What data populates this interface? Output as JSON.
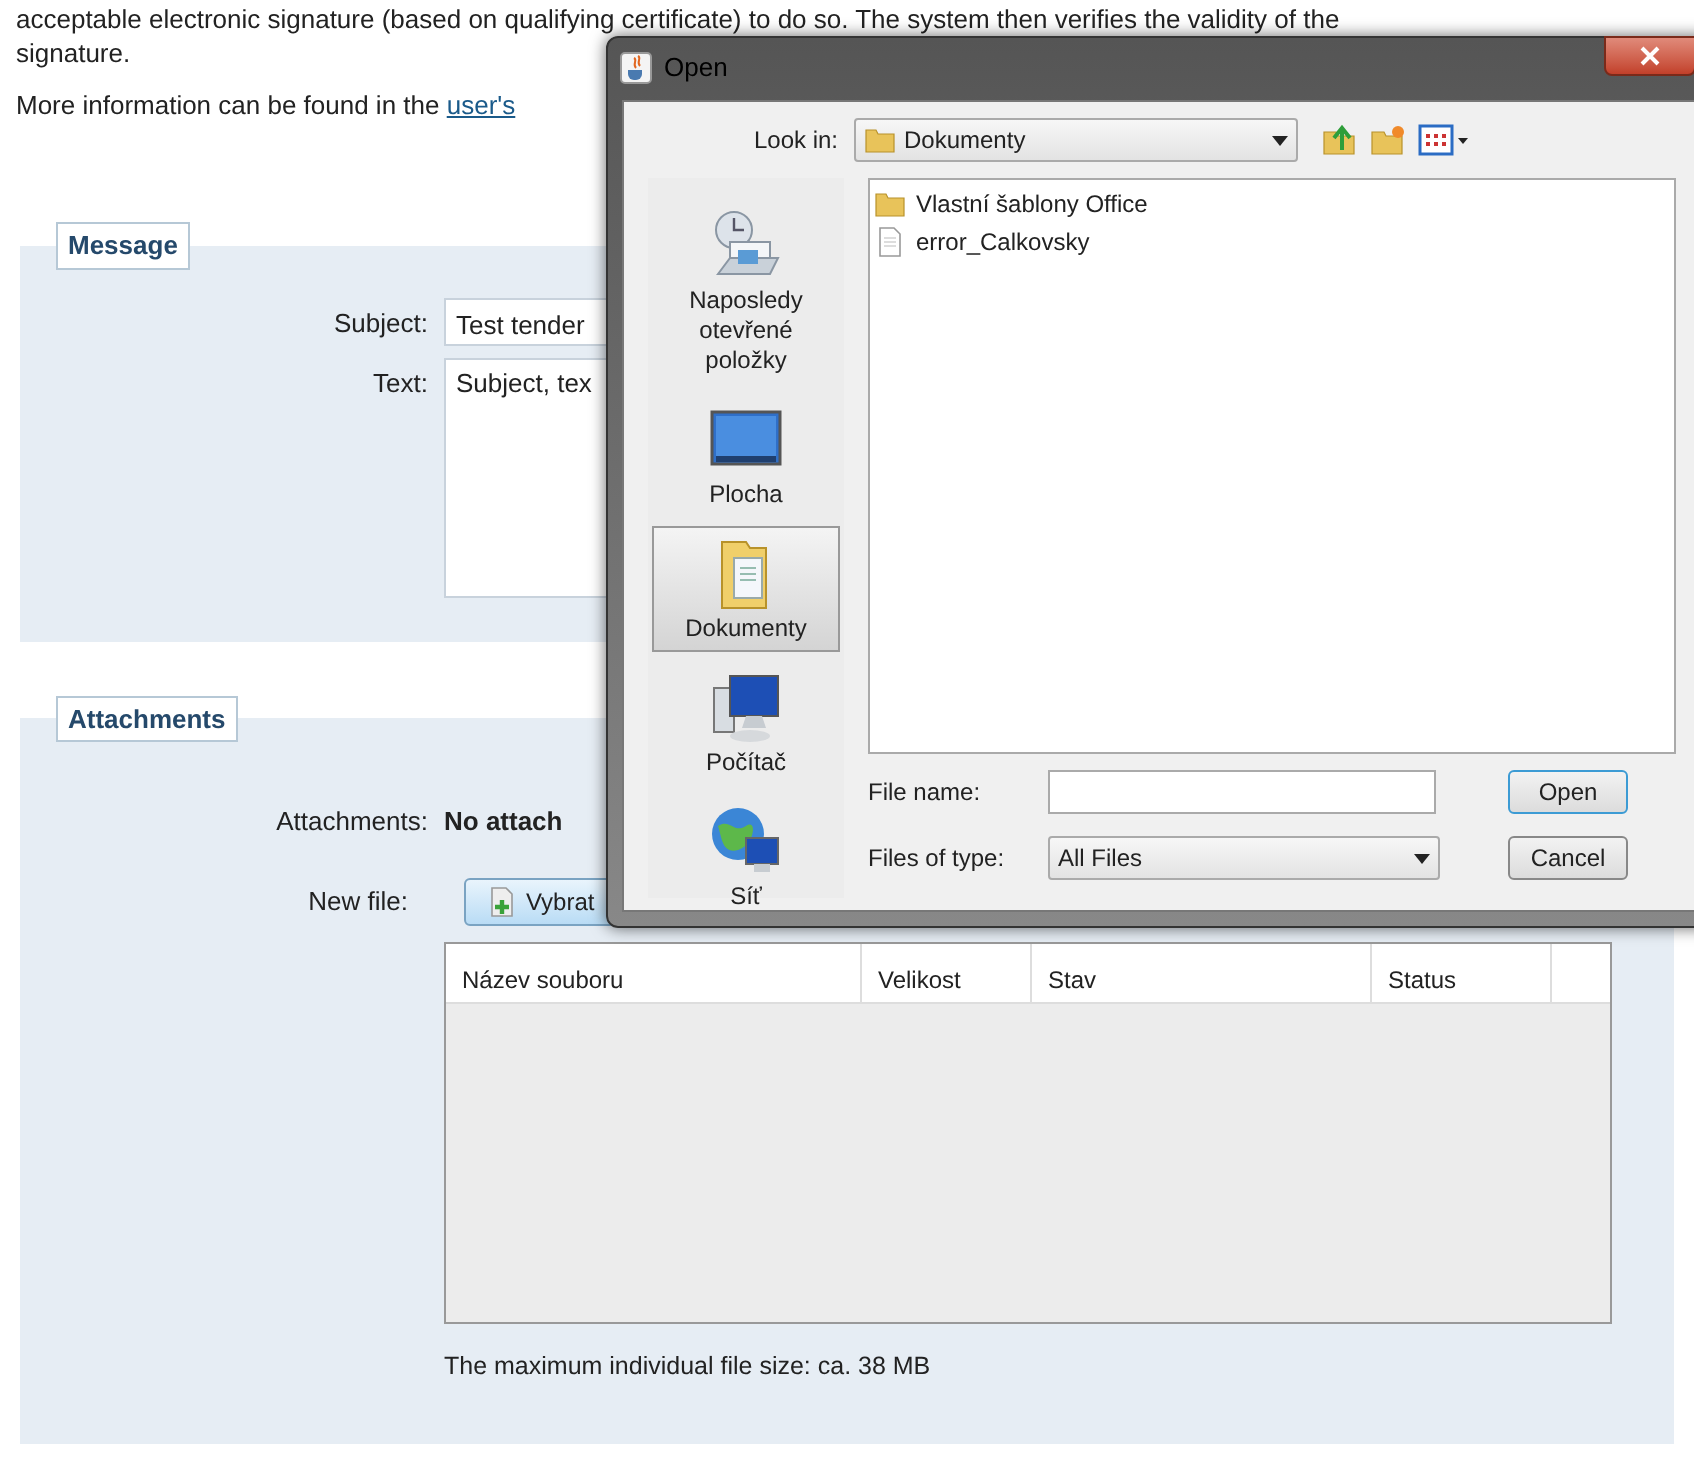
{
  "intro": {
    "lines": [
      "acceptable electronic signature (based on qualifying certificate) to do so. The system then verifies the validity of the",
      "signature."
    ],
    "more_text": "More information can be found in the ",
    "link": "user's"
  },
  "message": {
    "legend": "Message",
    "fields": [
      {
        "label": "Subject:",
        "value": "Test tender",
        "kind": "input"
      },
      {
        "label": "Text:",
        "value": "Subject, tex",
        "kind": "textarea"
      }
    ]
  },
  "attachments": {
    "legend": "Attachments",
    "label": "Attachments:",
    "value": "No attach",
    "new_file_label": "New file:",
    "choose_button": "Vybrat",
    "columns": [
      "Název souboru",
      "Velikost",
      "Stav",
      "Status"
    ],
    "note": "The maximum individual file size: ca. 38 MB"
  },
  "dialog": {
    "title": "Open",
    "look_in_label": "Look in:",
    "look_in_value": "Dokumenty",
    "places": [
      {
        "label": "Naposledy otevřené položky",
        "kind": "recent",
        "selected": false
      },
      {
        "label": "Plocha",
        "kind": "desktop",
        "selected": false
      },
      {
        "label": "Dokumenty",
        "kind": "documents",
        "selected": true
      },
      {
        "label": "Počítač",
        "kind": "computer",
        "selected": false
      },
      {
        "label": "Síť",
        "kind": "network",
        "selected": false
      }
    ],
    "files": [
      {
        "name": "Vlastní šablony Office",
        "kind": "folder"
      },
      {
        "name": "error_Calkovsky",
        "kind": "file"
      }
    ],
    "file_name_label": "File name:",
    "file_type_label": "Files of type:",
    "file_type_value": "All Files",
    "buttons": [
      "Open",
      "Cancel"
    ]
  }
}
